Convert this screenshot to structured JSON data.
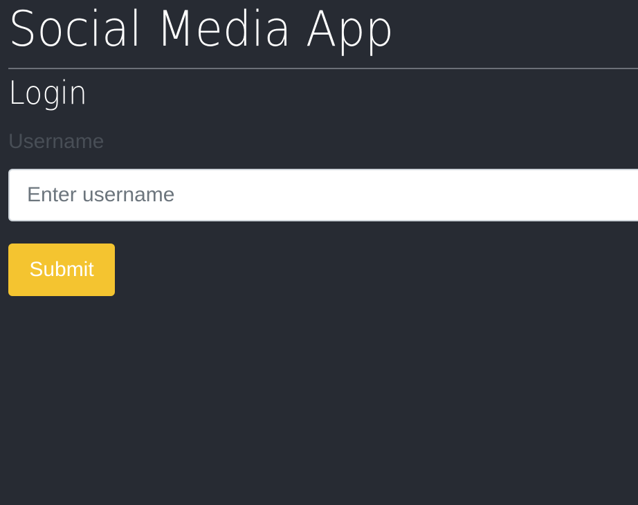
{
  "app": {
    "title": "Social Media App"
  },
  "login": {
    "heading": "Login",
    "username_label": "Username",
    "username_placeholder": "Enter username",
    "username_value": "",
    "submit_label": "Submit"
  },
  "colors": {
    "background": "#272b33",
    "divider": "#6c7078",
    "label": "#484e56",
    "input_background": "#ffffff",
    "input_border": "#ced4da",
    "placeholder": "#6c757d",
    "submit_background": "#f4c430",
    "submit_text": "#ffffff"
  }
}
